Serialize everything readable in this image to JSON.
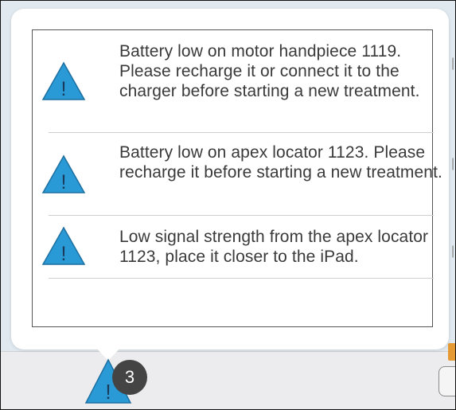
{
  "alerts": [
    {
      "severity_icon": "warning-triangle-icon",
      "message": "Battery low on motor handpiece 1119. Please recharge it or connect it to the charger before starting a new treatment."
    },
    {
      "severity_icon": "warning-triangle-icon",
      "message": "Battery low on apex locator 1123. Please recharge it before starting a new treatment."
    },
    {
      "severity_icon": "warning-triangle-icon",
      "message": "Low signal strength from the apex locator 1123, place it closer to the iPad."
    }
  ],
  "alert_button": {
    "icon": "warning-triangle-icon",
    "badge_count": "3"
  },
  "colors": {
    "warning": "#2a9ad6",
    "badge": "#444444",
    "accent": "#e69a34"
  }
}
